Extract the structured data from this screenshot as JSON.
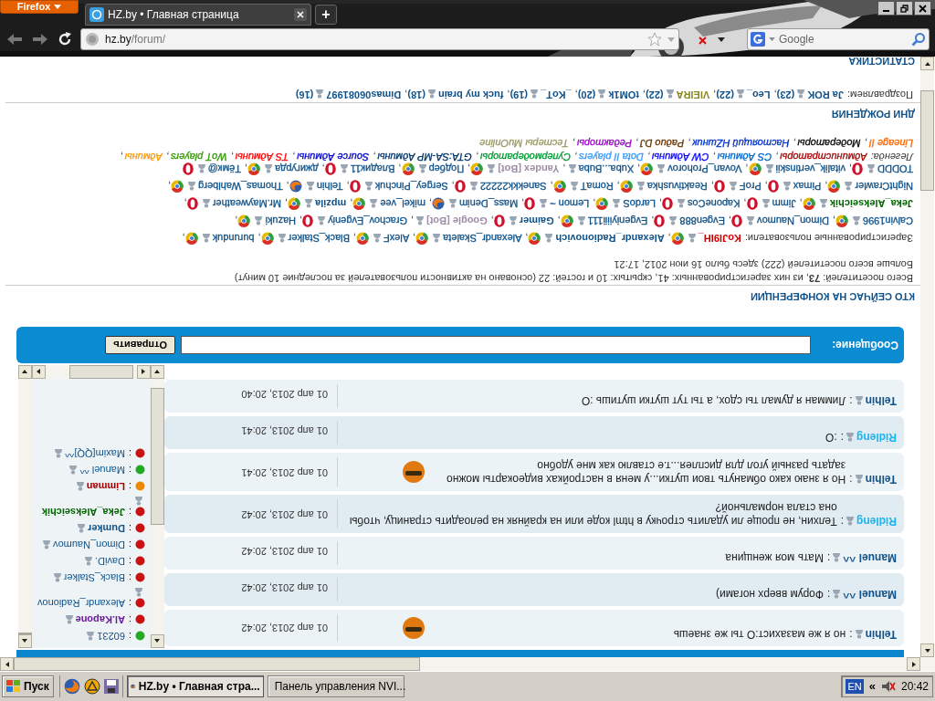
{
  "browser": {
    "menu_button": "Firefox",
    "tab_title": "HZ.by • Главная страница",
    "new_tab": "+",
    "url_host": "hz.by",
    "url_path": "/forum/",
    "search_placeholder": "Google"
  },
  "chat": {
    "separator": ":",
    "messages": [
      {
        "author": "Telhin",
        "color": "#105289",
        "text": "но я же мазахист:О ты же знаешь",
        "time": "01 апр 2013, 20:42",
        "smiley": true
      },
      {
        "author": "Manuel ^^",
        "color": "#105289",
        "text": "Форум вверх ногами)",
        "time": "01 апр 2013, 20:42",
        "smiley": false
      },
      {
        "author": "Manuel ^^",
        "color": "#105289",
        "text": "Мать моя женщина",
        "time": "01 апр 2013, 20:42",
        "smiley": false
      },
      {
        "author": "Ridleng",
        "color": "#1bb5f0",
        "text": "Телхин, не проще ли удалить строчку в html коде или на крайняк на релоадить страницу, чтобы она стала нормальной?",
        "time": "01 апр 2013, 20:42",
        "smiley": false
      },
      {
        "author": "Telhin",
        "color": "#105289",
        "text": "Но я знаю како обмануть твои шутки...у меня в настройках видеокарты можно задать разный угол для дисплея...т.е ставлю как мне удобно",
        "time": "01 апр 2013, 20:41",
        "smiley": true
      },
      {
        "author": "Ridleng",
        "color": "#1bb5f0",
        "text": ":O",
        "time": "01 апр 2013, 20:41",
        "smiley": false
      },
      {
        "author": "Telhin",
        "color": "#105289",
        "text": "Лимман я думал ты сдох, а ты тут шутки шутишь :O",
        "time": "01 апр 2013, 20:40",
        "smiley": false
      }
    ],
    "users": [
      {
        "status": {
          "color": "#22aa22"
        },
        "name": {
          "text": "60231",
          "color": "#105289",
          "bold": false
        }
      },
      {
        "status": {
          "color": "#cc1111"
        },
        "name": {
          "text": "Al.Kapone",
          "color": "#6a1b9a",
          "bold": true
        }
      },
      {
        "status": {
          "color": "#cc1111"
        },
        "name": {
          "text": "Alexandr_Radionov",
          "color": "#105289",
          "bold": false
        }
      },
      {
        "status": {
          "color": "#cc1111"
        },
        "name": {
          "text": "Black_Stalker",
          "color": "#105289",
          "bold": false
        }
      },
      {
        "status": {
          "color": "#cc1111"
        },
        "name": {
          "text": "DaviD.",
          "color": "#105289",
          "bold": false
        }
      },
      {
        "status": {
          "color": "#cc1111"
        },
        "name": {
          "text": "Dimon_Naumov",
          "color": "#105289",
          "bold": false
        }
      },
      {
        "status": {
          "color": "#cc1111"
        },
        "name": {
          "text": "Dumker",
          "color": "#105289",
          "bold": true
        }
      },
      {
        "status": {
          "color": "#cc1111"
        },
        "name": {
          "text": "Jeka_Alekseichik",
          "color": "#006600",
          "bold": true
        }
      },
      {
        "status": {
          "color": "#ee8800"
        },
        "name": {
          "text": "Limman",
          "color": "#aa0000",
          "bold": true
        }
      },
      {
        "status": {
          "color": "#22aa22"
        },
        "name": {
          "text": "Manuel ^^",
          "color": "#105289",
          "bold": false
        }
      },
      {
        "status": {
          "color": "#cc1111"
        },
        "name": {
          "text": "Maxim[QQ]^^",
          "color": "#105289",
          "bold": false
        }
      }
    ],
    "message_label": "Сообщение:",
    "send_button": "Отправить"
  },
  "online": {
    "heading": "КТО СЕЙЧАС НА КОНФЕРЕНЦИИ",
    "summary": "Всего посетителей: **73**, из них зарегистрированных: 41, скрытых: 10 и гостей: 22 (основано на активности пользователей за последние 10 минут)",
    "record": "Больше всего посетителей (222) здесь было 16 июн 2012, 17:21",
    "registered_label": "Зарегистрированные пользователи:",
    "separator": ",",
    "registered": [
      {
        "name": "KoJI9IH_",
        "color": "#cc0000",
        "bold": true,
        "kind": "chrome"
      },
      {
        "name": "Alexandr_Radionovich",
        "color": "#105289",
        "bold": true,
        "kind": "chrome"
      },
      {
        "name": "Alexandr_Skaleta",
        "color": "#105289",
        "bold": false,
        "kind": "chrome"
      },
      {
        "name": "AlexF",
        "color": "#105289",
        "bold": false,
        "kind": "chrome"
      },
      {
        "name": "Black_Stalker",
        "color": "#105289",
        "bold": false,
        "kind": "chrome"
      },
      {
        "name": "burunduk",
        "color": "#105289",
        "bold": false,
        "kind": "chrome"
      },
      {
        "name": "Calvin1996",
        "color": "#105289",
        "bold": false,
        "kind": "chrome"
      },
      {
        "name": "Dimon_Naumov",
        "color": "#105289",
        "bold": false,
        "kind": "opera"
      },
      {
        "name": "Evgen888",
        "color": "#105289",
        "bold": false,
        "kind": "opera"
      },
      {
        "name": "Evgeniyiiii111",
        "color": "#105289",
        "bold": false,
        "kind": "chrome"
      },
      {
        "name": "Gaimer",
        "color": "#105289",
        "bold": true,
        "kind": "opera"
      },
      {
        "name": "Google [Bot]",
        "color": "#9e8da7",
        "bold": true,
        "kind": "none"
      },
      {
        "name": "Grachov_Evgeniy",
        "color": "#105289",
        "bold": false,
        "kind": "opera"
      },
      {
        "name": "Hazuki",
        "color": "#105289",
        "bold": false,
        "kind": "chrome"
      },
      {
        "name": "Jeka_Alekseichik",
        "color": "#006600",
        "bold": true,
        "kind": "chrome"
      },
      {
        "name": "Jimm",
        "color": "#105289",
        "bold": false,
        "kind": "opera"
      },
      {
        "name": "KaponeCos",
        "color": "#105289",
        "bold": false,
        "kind": "opera"
      },
      {
        "name": "LardoS",
        "color": "#105289",
        "bold": false,
        "kind": "chrome"
      },
      {
        "name": "Lemon ~",
        "color": "#105289",
        "bold": false,
        "kind": "opera"
      },
      {
        "name": "Mass_Denim",
        "color": "#105289",
        "bold": false,
        "kind": "firefox"
      },
      {
        "name": "mikel_vee",
        "color": "#105289",
        "bold": false,
        "kind": "chrome"
      },
      {
        "name": "mpzila",
        "color": "#105289",
        "bold": true,
        "kind": "chrome"
      },
      {
        "name": "Mr.Mayweather",
        "color": "#105289",
        "bold": false,
        "kind": "opera"
      },
      {
        "name": "NightCrawler",
        "color": "#105289",
        "bold": false,
        "kind": "chrome"
      },
      {
        "name": "Pimax",
        "color": "#105289",
        "bold": false,
        "kind": "opera"
      },
      {
        "name": "ProF",
        "color": "#105289",
        "bold": false,
        "kind": "opera"
      },
      {
        "name": "Reaktivushka",
        "color": "#105289",
        "bold": false,
        "kind": "chrome"
      },
      {
        "name": "RomaT",
        "color": "#105289",
        "bold": false,
        "kind": "chrome"
      },
      {
        "name": "Sanekkk22222",
        "color": "#105289",
        "bold": false,
        "kind": "opera"
      },
      {
        "name": "Sergey_Pinchuk",
        "color": "#105289",
        "bold": false,
        "kind": "opera"
      },
      {
        "name": "Telhin",
        "color": "#105289",
        "bold": false,
        "kind": "firefox"
      },
      {
        "name": "Thomas_Wahlberg",
        "color": "#105289",
        "bold": false,
        "kind": "chrome"
      },
      {
        "name": "TODDD",
        "color": "#105289",
        "bold": false,
        "kind": "opera"
      },
      {
        "name": "vitalik_vertinskii",
        "color": "#105289",
        "bold": false,
        "kind": "chrome"
      },
      {
        "name": "Vovan_Prohorov",
        "color": "#105289",
        "bold": false,
        "kind": "chrome"
      },
      {
        "name": "Xuba...Buba",
        "color": "#105289",
        "bold": false,
        "kind": "none"
      },
      {
        "name": "Yandex [Bot]",
        "color": "#9e8da7",
        "bold": true,
        "kind": "chrome"
      },
      {
        "name": "Подбер",
        "color": "#105289",
        "bold": false,
        "kind": "chrome"
      },
      {
        "name": "Владик11",
        "color": "#105289",
        "bold": false,
        "kind": "opera"
      },
      {
        "name": "джигурда",
        "color": "#105289",
        "bold": false,
        "kind": "chrome"
      },
      {
        "name": "Тёмк@",
        "color": "#105289",
        "bold": false,
        "kind": "opera"
      }
    ],
    "legend_label": "Легенда:",
    "legend_lines": [
      [
        {
          "name": "Администраторы",
          "color": "#aa0000"
        },
        {
          "name": "CS Админы",
          "color": "#0066cc"
        },
        {
          "name": "CW Админы",
          "color": "#0000ff"
        },
        {
          "name": "Dota II players",
          "color": "#3399ff"
        },
        {
          "name": "Супермодераторы",
          "color": "#009933"
        },
        {
          "name": "GTA:SA-MP Админы",
          "color": "#003366"
        },
        {
          "name": "Source Админы",
          "color": "#0000cc"
        },
        {
          "name": "TS Админы",
          "color": "#ff0000"
        },
        {
          "name": "WoT players",
          "color": "#339900"
        },
        {
          "name": "Админы",
          "color": "#ff9900"
        }
      ],
      [
        {
          "name": "Lineage II",
          "color": "#ff6600"
        },
        {
          "name": "Модераторы",
          "color": "#000000"
        },
        {
          "name": "Настоящий HZшник",
          "color": "#0033cc"
        },
        {
          "name": "Радио DJ",
          "color": "#663300"
        },
        {
          "name": "Редакторы",
          "color": "#9900cc"
        },
        {
          "name": "Тестеры MuOnline",
          "color": "#999966"
        }
      ]
    ]
  },
  "birthdays": {
    "heading": "ДНИ РОЖДЕНИЯ",
    "label": "Поздравляем:",
    "people": [
      {
        "name": "Ja ROK",
        "age": "(23)",
        "color": "#105289"
      },
      {
        "name": "Leo_",
        "age": "(22)",
        "color": "#105289"
      },
      {
        "name": "VIEIRA",
        "age": "(22)",
        "color": "#8a8a22"
      },
      {
        "name": "tOM1k",
        "age": "(20)",
        "color": "#105289"
      },
      {
        "name": "_KoT_",
        "age": "(19)",
        "color": "#105289"
      },
      {
        "name": "fuck my brain",
        "age": "(18)",
        "color": "#105289"
      },
      {
        "name": "Dimas06081997",
        "age": "(16)",
        "color": "#105289"
      }
    ]
  },
  "statistics": {
    "heading": "СТАТИСТИКА"
  },
  "taskbar": {
    "start": "Пуск",
    "tasks": [
      {
        "label": "HZ.by • Главная стра...",
        "selected": true
      },
      {
        "label": "Панель управления NVI...",
        "selected": false
      }
    ],
    "language": "EN",
    "tray_toggle": "«",
    "clock": "20:42"
  }
}
